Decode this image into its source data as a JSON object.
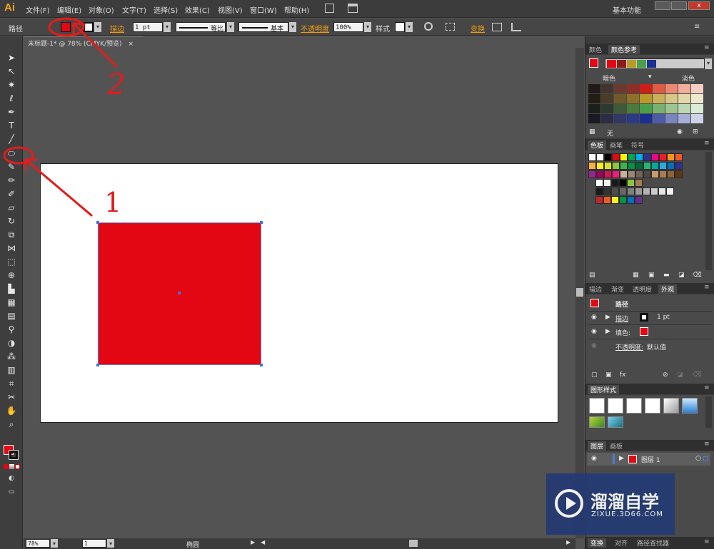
{
  "app": {
    "logo": "Ai",
    "menus": [
      "文件(F)",
      "编辑(E)",
      "对象(O)",
      "文字(T)",
      "选择(S)",
      "效果(C)",
      "视图(V)",
      "窗口(W)",
      "帮助(H)"
    ],
    "workspace": "基本功能"
  },
  "control": {
    "object_type": "路径",
    "stroke_label": "描边",
    "stroke_weight": "1 pt",
    "profile_label": "等比",
    "brush_label": "基本",
    "opacity_label": "不透明度",
    "opacity_value": "100%",
    "style_label": "样式",
    "transform_label": "变换",
    "fill_color": "#e30613"
  },
  "document": {
    "tab_title": "未标题-1* @ 78% (CMYK/预览)",
    "close": "×"
  },
  "status": {
    "zoom": "78%",
    "page": "1",
    "tool_name": "椭圆"
  },
  "color_guide": {
    "tabs": [
      "颜色",
      "颜色参考"
    ],
    "dark_label": "暗色",
    "light_label": "淡色",
    "none_label": "无"
  },
  "swatches": {
    "tabs": [
      "色板",
      "画笔",
      "符号"
    ]
  },
  "appearance": {
    "tabs": [
      "描边",
      "渐变",
      "透明度",
      "外观"
    ],
    "path_label": "路径",
    "stroke_row": "描边",
    "stroke_value": "1 pt",
    "fill_row": "填色:",
    "opacity_row": "不透明度:",
    "opacity_value": "默认值"
  },
  "graphic_styles": {
    "title": "图形样式"
  },
  "layers": {
    "tabs": [
      "图层",
      "画板"
    ],
    "layer_name": "图层 1"
  },
  "bottom_tabs": [
    "变换",
    "对齐",
    "路径查找器"
  ],
  "watermark": {
    "title": "溜溜自学",
    "url": "ZIXUE.3D66.COM"
  },
  "annotations": {
    "one": "1",
    "two": "2"
  }
}
